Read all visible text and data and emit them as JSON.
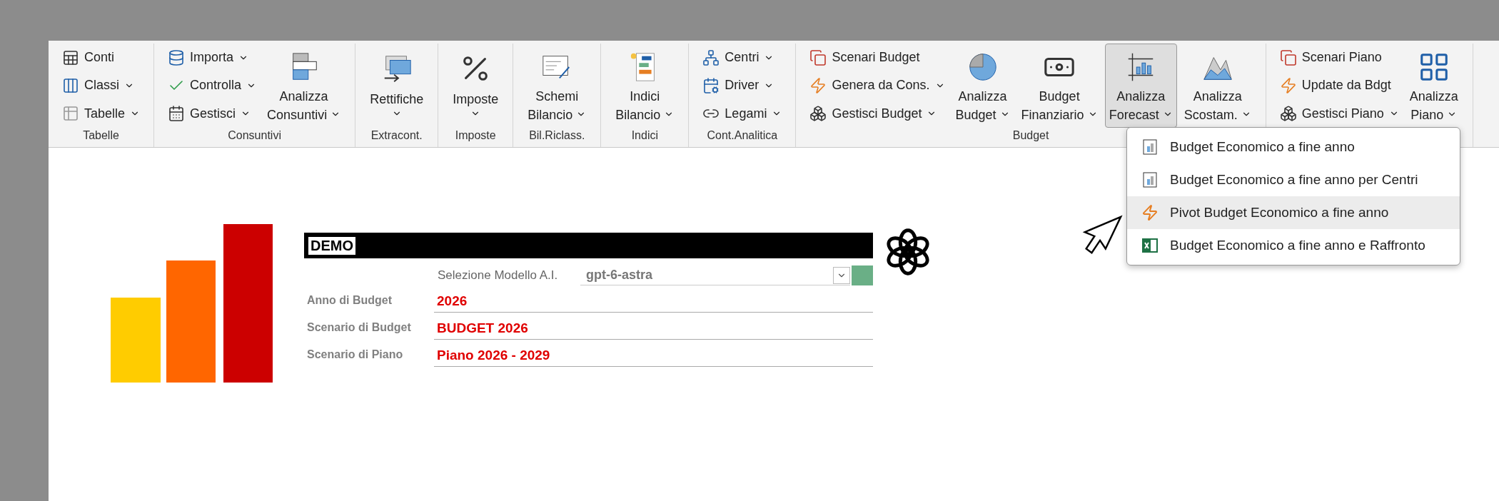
{
  "ribbon": {
    "groups": [
      {
        "label": "Tabelle",
        "columns": [
          {
            "kind": "stack",
            "buttons": [
              {
                "label": "Conti",
                "dropdown": false
              },
              {
                "label": "Classi",
                "dropdown": true
              },
              {
                "label": "Tabelle",
                "dropdown": true
              }
            ]
          }
        ]
      },
      {
        "label": "Consuntivi",
        "columns": [
          {
            "kind": "stack",
            "buttons": [
              {
                "label": "Importa",
                "dropdown": true
              },
              {
                "label": "Controlla",
                "dropdown": true
              },
              {
                "label": "Gestisci",
                "dropdown": true
              }
            ]
          },
          {
            "kind": "large",
            "lines": [
              "Analizza",
              "Consuntivi"
            ],
            "dropdown": true,
            "open": false
          }
        ]
      },
      {
        "label": "Extracont.",
        "columns": [
          {
            "kind": "large",
            "lines": [
              "Rettifiche"
            ],
            "dropdown": true,
            "open": false
          }
        ]
      },
      {
        "label": "Imposte",
        "columns": [
          {
            "kind": "large",
            "lines": [
              "Imposte"
            ],
            "dropdown": true,
            "open": false
          }
        ]
      },
      {
        "label": "Bil.Riclass.",
        "columns": [
          {
            "kind": "large",
            "lines": [
              "Schemi",
              "Bilancio"
            ],
            "dropdown": true,
            "open": false
          }
        ]
      },
      {
        "label": "Indici",
        "columns": [
          {
            "kind": "large",
            "lines": [
              "Indici",
              "Bilancio"
            ],
            "dropdown": true,
            "open": false
          }
        ]
      },
      {
        "label": "Cont.Analitica",
        "columns": [
          {
            "kind": "stack",
            "buttons": [
              {
                "label": "Centri",
                "dropdown": true
              },
              {
                "label": "Driver",
                "dropdown": true
              },
              {
                "label": "Legami",
                "dropdown": true
              }
            ]
          }
        ]
      },
      {
        "label": "Budget",
        "columns": [
          {
            "kind": "stack",
            "buttons": [
              {
                "label": "Scenari Budget",
                "dropdown": false
              },
              {
                "label": "Genera da Cons.",
                "dropdown": true
              },
              {
                "label": "Gestisci Budget",
                "dropdown": true
              }
            ]
          },
          {
            "kind": "large",
            "lines": [
              "Analizza",
              "Budget"
            ],
            "dropdown": true,
            "open": false
          },
          {
            "kind": "large",
            "lines": [
              "Budget",
              "Finanziario"
            ],
            "dropdown": true,
            "open": false
          },
          {
            "kind": "large",
            "lines": [
              "Analizza",
              "Forecast"
            ],
            "dropdown": true,
            "open": true
          },
          {
            "kind": "large",
            "lines": [
              "Analizza",
              "Scostam."
            ],
            "dropdown": true,
            "open": false
          }
        ]
      },
      {
        "columns": [
          {
            "kind": "stack",
            "buttons": [
              {
                "label": "Scenari Piano",
                "dropdown": false
              },
              {
                "label": "Update da Bdgt",
                "dropdown": false
              },
              {
                "label": "Gestisci Piano",
                "dropdown": true
              }
            ]
          },
          {
            "kind": "large",
            "lines": [
              "Analizza",
              "Piano"
            ],
            "dropdown": true,
            "open": false
          }
        ]
      }
    ]
  },
  "menu": {
    "items": [
      {
        "label": "Budget Economico a fine anno",
        "selected": false
      },
      {
        "label": "Budget Economico a fine anno per Centri",
        "selected": false
      },
      {
        "label": "Pivot Budget Economico a fine anno",
        "selected": true
      },
      {
        "label": "Budget Economico a fine anno e Raffronto",
        "selected": false
      }
    ]
  },
  "sheet": {
    "banner": "DEMO",
    "model": {
      "label": "Selezione Modello A.I.",
      "value": "gpt-6-astra"
    },
    "fields": [
      {
        "label": "Anno di Budget",
        "value": "2026"
      },
      {
        "label": "Scenario di Budget",
        "value": "BUDGET 2026"
      },
      {
        "label": "Scenario di Piano",
        "value": "Piano 2026 - 2029"
      }
    ]
  }
}
